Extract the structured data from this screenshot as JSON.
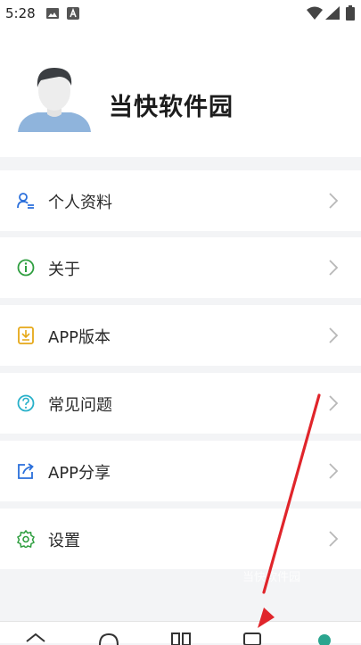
{
  "status_bar": {
    "time": "5:28",
    "icons": [
      "image-icon",
      "a-badge-icon",
      "wifi-icon",
      "signal-icon",
      "battery-icon"
    ]
  },
  "profile": {
    "name": "当快软件园",
    "avatar_icon": "default-avatar"
  },
  "menu": [
    {
      "label": "个人资料",
      "icon": "user-profile-icon",
      "icon_color": "#2a6fdb"
    },
    {
      "label": "关于",
      "icon": "info-icon",
      "icon_color": "#2e9e3f"
    },
    {
      "label": "APP版本",
      "icon": "app-version-icon",
      "icon_color": "#e6a817"
    },
    {
      "label": "常见问题",
      "icon": "question-icon",
      "icon_color": "#27b0c9"
    },
    {
      "label": "APP分享",
      "icon": "share-icon",
      "icon_color": "#2a6fdb"
    },
    {
      "label": "设置",
      "icon": "settings-icon",
      "icon_color": "#2e9e3f"
    }
  ],
  "watermark": "当快软件园",
  "bottom_nav": {
    "items": [
      "layers-icon",
      "search-icon",
      "grid-icon",
      "tablet-icon",
      "profile-icon"
    ]
  },
  "colors": {
    "accent_arrow": "#e0252b",
    "chevron": "#b8b8b8",
    "background": "#f3f4f6"
  }
}
